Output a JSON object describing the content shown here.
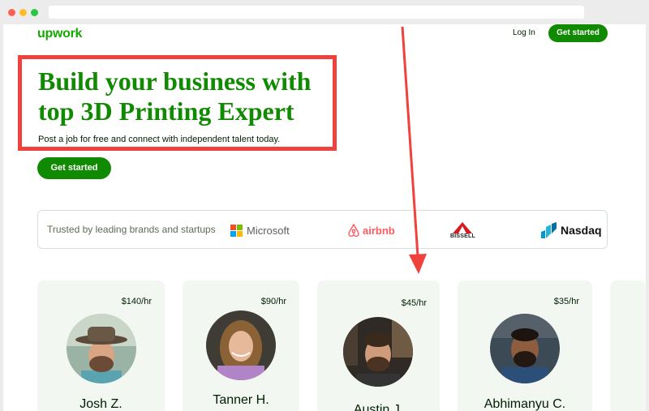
{
  "header": {
    "logo": "upwork",
    "login_label": "Log In",
    "get_started_label": "Get started"
  },
  "hero": {
    "title": "Build your business with top 3D Printing Expert",
    "subtitle": "Post a job for free and connect with independent talent today.",
    "cta_label": "Get started"
  },
  "trusted": {
    "label": "Trusted by leading brands and startups",
    "brands": [
      "Microsoft",
      "airbnb",
      "BISSELL",
      "Nasdaq"
    ]
  },
  "freelancers": [
    {
      "name": "Josh Z.",
      "rate": "$140/hr"
    },
    {
      "name": "Tanner H.",
      "rate": "$90/hr"
    },
    {
      "name": "Austin J.",
      "rate": "$45/hr"
    },
    {
      "name": "Abhimanyu C.",
      "rate": "$35/hr"
    }
  ],
  "colors": {
    "brand_green": "#14a800",
    "button_green": "#108a00",
    "highlight_red": "#f0423c"
  }
}
